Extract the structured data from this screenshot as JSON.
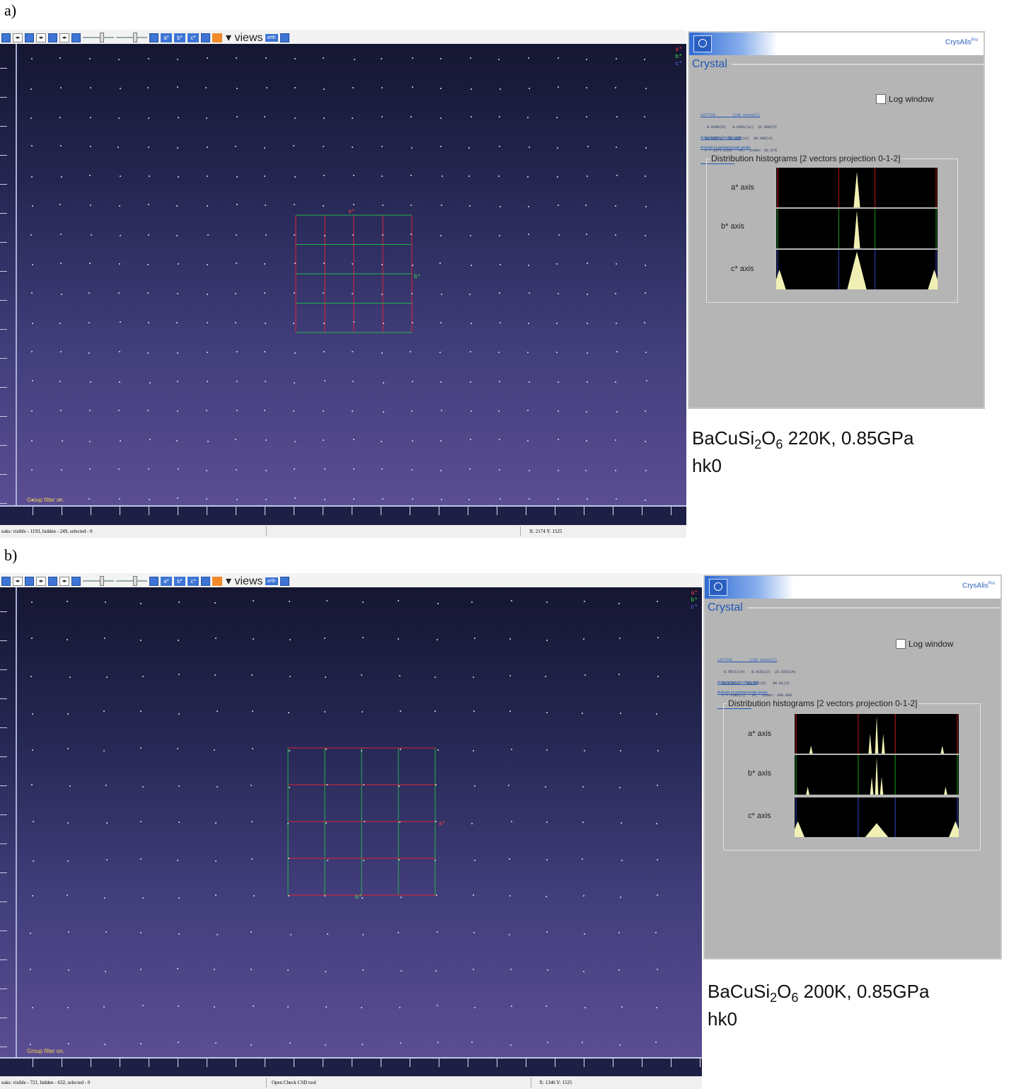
{
  "panels": [
    {
      "label": "a)",
      "toolbar": {
        "views_label": "views",
        "ortho_label": "orth"
      },
      "axis_tags": {
        "a": "a*",
        "b": "b*",
        "c": "c*"
      },
      "grid_tags": {
        "top": "a*",
        "side": "b*"
      },
      "group_filter": "Group filter on.",
      "status_left": "eaks: visible - 1193, hidden - 249, selected - 0",
      "status_mid": "",
      "status_right": "X: 2174  Y: 1525",
      "crystal": {
        "title": "Crystal",
        "brand": "CrysAlis",
        "brand_sup": "Pro",
        "log_window": "Log window",
        "lattice_head": "LATTICE        (CSD install)",
        "lattice_lines": [
          "   9.9396(9)   9.9351(12)  22.068(5)",
          "  90.005(8)  90.022(12)  89.998(4)",
          "  V = 2177.2(6)   tP,  index: 82.67%",
          "     Overlap off"
        ],
        "link_twin": "Activate twin / multicrystal",
        "link_incomm": "Activate incommensurate peaks",
        "dist_title": "Distribution histograms [2 vectors projection 0-1-2]",
        "axes": [
          "a*  axis",
          "b*  axis",
          "c*  axis"
        ]
      },
      "caption": {
        "formula_pre": "BaCuSi",
        "sub1": "2",
        "formula_mid": "O",
        "sub2": "6",
        "formula_post": " 220K, 0.85GPa",
        "line2": "hk0"
      }
    },
    {
      "label": "b)",
      "toolbar": {
        "views_label": "views",
        "ortho_label": "orth"
      },
      "axis_tags": {
        "a": "a*",
        "b": "b*",
        "c": "c*"
      },
      "grid_tags": {
        "top": "b*",
        "side": "a*"
      },
      "group_filter": "Group filter on.",
      "status_left": "eaks: visible - 721, hidden - 632, selected - 0",
      "status_mid": "Open Check CSD tool",
      "status_right": "X: 1346  Y: 1525",
      "crystal": {
        "title": "Crystal",
        "brand": "CrysAlis",
        "brand_sup": "Pro",
        "log_window": "Log window",
        "lattice_head": "LATTICE        (CSD install)",
        "lattice_lines": [
          "   9.9571(14)   9.9182(3)  22.035(14)",
          "  90.031(8)   89.971(8)   90.01(3)",
          "  V = 2182(2)   tP,  index: 100.00%",
          "     Overlap off"
        ],
        "link_twin": "Activate twin / multicrystal",
        "link_incomm": "Activate incommensurate peaks",
        "dist_title": "Distribution histograms [2 vectors projection 0-1-2]",
        "axes": [
          "a*  axis",
          "b*  axis",
          "c*  axis"
        ]
      },
      "caption": {
        "formula_pre": "BaCuSi",
        "sub1": "2",
        "formula_mid": "O",
        "sub2": "6",
        "formula_post": " 200K, 0.85GPa",
        "line2": "hk0"
      }
    }
  ],
  "colors": {
    "grid_red": "#e0213a",
    "grid_green": "#22b24c",
    "hist_red": "#c41a1a",
    "hist_green": "#1a9e1a",
    "hist_peak": "#f0f0b4"
  }
}
